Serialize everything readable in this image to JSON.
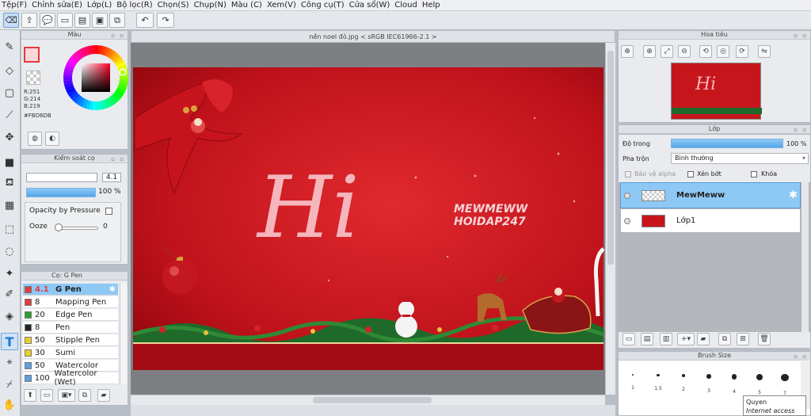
{
  "menu": [
    "Tệp(F)",
    "Chỉnh sửa(E)",
    "Lớp(L)",
    "Bộ lọc(R)",
    "Chọn(S)",
    "Chụp(N)",
    "Màu (C)",
    "Xem(V)",
    "Công cụ(T)",
    "Cửa sổ(W)",
    "Cloud",
    "Help"
  ],
  "document": {
    "tab_title": "nền noel đỏ.jpg < sRGB IEC61966-2.1 >"
  },
  "color_panel": {
    "title": "Màu",
    "r": "R:251",
    "g": "G:214",
    "b": "B:219",
    "hex": "#FBD6DB",
    "main_color": "#fbd6db"
  },
  "brush_control": {
    "title": "Kiểm soát cọ",
    "size_value": "4.1",
    "opacity_value": "100 %",
    "opacity_pressure_label": "Opacity by Pressure",
    "ooze_label": "Ooze",
    "ooze_value": "0"
  },
  "brush_list": {
    "title": "Cọ: G Pen",
    "items": [
      {
        "size": "4.1",
        "name": "G Pen",
        "color": "#e33b3b"
      },
      {
        "size": "8",
        "name": "Mapping Pen",
        "color": "#e33b3b"
      },
      {
        "size": "20",
        "name": "Edge Pen",
        "color": "#2aa02a"
      },
      {
        "size": "8",
        "name": "Pen",
        "color": "#222222"
      },
      {
        "size": "50",
        "name": "Stipple Pen",
        "color": "#e8d12a"
      },
      {
        "size": "30",
        "name": "Sumi",
        "color": "#e8d12a"
      },
      {
        "size": "50",
        "name": "Watercolor",
        "color": "#5aa0e6"
      },
      {
        "size": "100",
        "name": "Watercolor (Wet)",
        "color": "#5aa0e6"
      }
    ]
  },
  "navigator": {
    "title": "Hoa tiêu"
  },
  "layer_panel": {
    "title": "Lớp",
    "opacity_label": "Độ trong",
    "opacity_value": "100 %",
    "opacity_fraction": 1.0,
    "blend_label": "Pha trộn",
    "blend_value": "Bình thường",
    "protect_alpha": "Bảo vệ alpha",
    "clipping": "Xén bớt",
    "lock": "Khóa",
    "layers": [
      {
        "name": "MewMeww",
        "selected": true
      },
      {
        "name": "Lớp1",
        "selected": false
      }
    ]
  },
  "brush_size_panel": {
    "title": "Brush Size",
    "sizes": [
      "1",
      "1.5",
      "2",
      "3",
      "4",
      "5",
      "7"
    ]
  },
  "artwork": {
    "hi_text": "Hi",
    "line1": "MEWMEWW",
    "line2": "HOIDAP247"
  },
  "tooltip": {
    "user": "Quyen",
    "status": "Internet access"
  }
}
